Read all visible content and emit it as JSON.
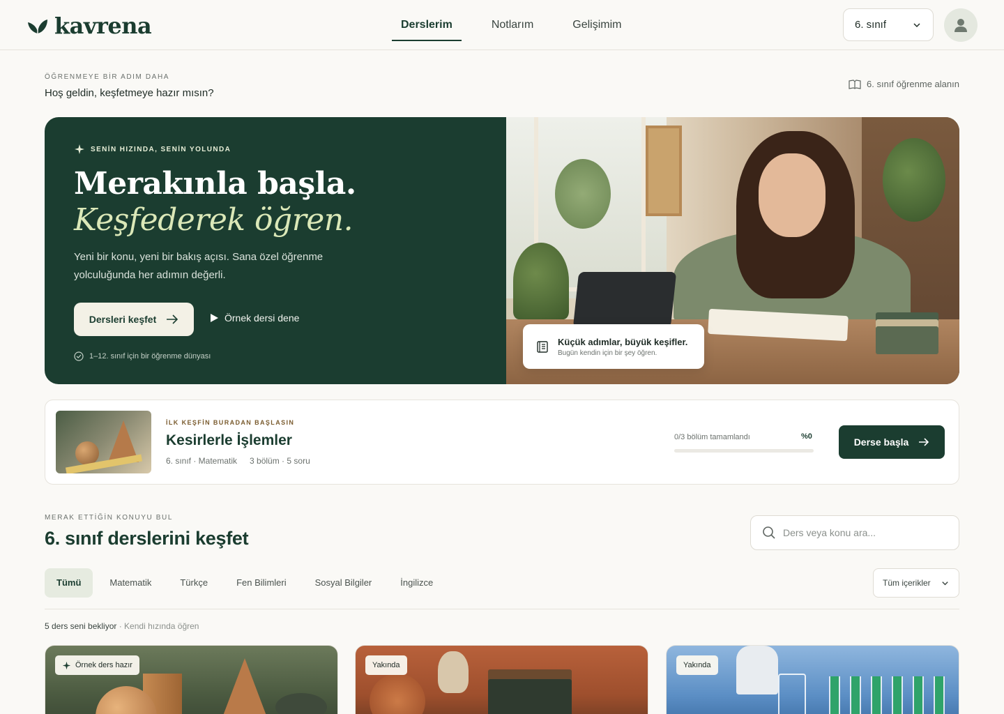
{
  "app": {
    "logo_text": "kavrena",
    "brand_color": "#1b3d30",
    "accent_color": "#dbe8b8"
  },
  "header": {
    "nav": [
      {
        "label": "Derslerim",
        "active": true
      },
      {
        "label": "Notlarım",
        "active": false
      },
      {
        "label": "Gelişimim",
        "active": false
      }
    ],
    "grade_select": "6. sınıf",
    "avatar_icon": "user-icon"
  },
  "welcome": {
    "eyebrow": "ÖĞRENMEYE BİR ADIM DAHA",
    "title": "Hoş geldin, keşfetmeye hazır mısın?",
    "area_link": "6. sınıf öğrenme alanın"
  },
  "hero": {
    "eyebrow": "SENİN HIZINDA, SENİN YOLUNDA",
    "headline_1": "Merakınla başla.",
    "headline_2": "Keşfederek öğren.",
    "subtitle": "Yeni bir konu, yeni bir bakış açısı. Sana özel öğrenme yolculuğunda her adımın değerli.",
    "primary_button": "Dersleri keşfet",
    "secondary_button": "Örnek dersi dene",
    "note": "1–12. sınıf için bir öğrenme dünyası",
    "photo_card": {
      "title": "Küçük adımlar, büyük keşifler.",
      "subtitle": "Bugün kendin için bir şey öğren."
    }
  },
  "start_lesson": {
    "eyebrow": "İLK KEŞFİN BURADAN BAŞLASIN",
    "title": "Kesirlerle İşlemler",
    "meta_grade": "6. sınıf · Matematik",
    "meta_size": "3 bölüm · 5 soru",
    "progress_label": "0/3 bölüm tamamlandı",
    "progress_percent_text": "%0",
    "progress_fraction": 0,
    "button": "Derse başla"
  },
  "discover": {
    "eyebrow": "MERAK ETTİĞİN KONUYU BUL",
    "title": "6. sınıf derslerini keşfet",
    "search_placeholder": "Ders veya konu ara...",
    "tabs": [
      {
        "label": "Tümü",
        "active": true
      },
      {
        "label": "Matematik",
        "active": false
      },
      {
        "label": "Türkçe",
        "active": false
      },
      {
        "label": "Fen Bilimleri",
        "active": false
      },
      {
        "label": "Sosyal Bilgiler",
        "active": false
      },
      {
        "label": "İngilizce",
        "active": false
      }
    ],
    "filter_select": "Tüm içerikler",
    "count_main": "5 ders seni bekliyor",
    "count_sub": " · Kendi hızında öğren"
  },
  "courses": [
    {
      "badge": "Örnek ders hazır",
      "badge_icon": "sparkle-icon"
    },
    {
      "badge": "Yakında"
    },
    {
      "badge": "Yakında"
    }
  ]
}
